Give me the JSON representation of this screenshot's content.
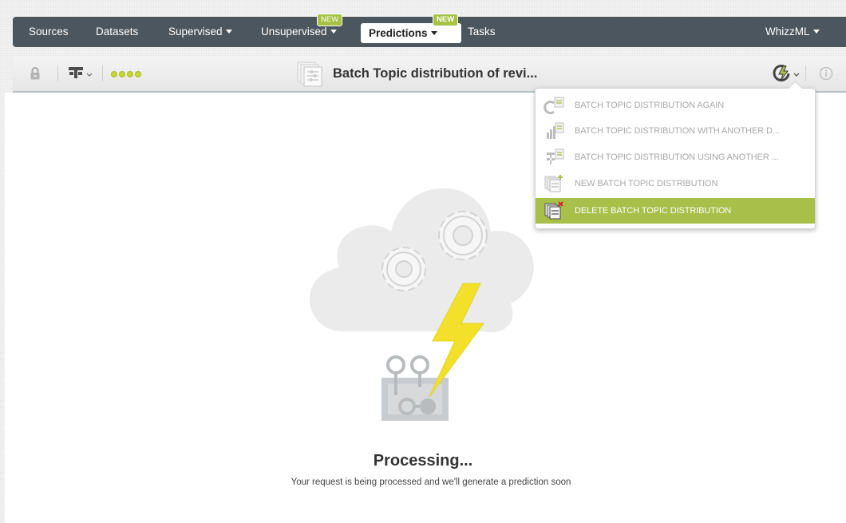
{
  "nav": {
    "items": [
      {
        "label": "Sources"
      },
      {
        "label": "Datasets"
      },
      {
        "label": "Supervised"
      },
      {
        "label": "Unsupervised",
        "badge": "NEW"
      },
      {
        "label": "Predictions",
        "badge": "NEW"
      },
      {
        "label": "Tasks"
      }
    ],
    "user_menu": "WhizzML"
  },
  "toolbar": {
    "title": "Batch Topic distribution of revi...",
    "lock_icon": "lock-icon",
    "tree_icon": "model-tree-icon",
    "actions_icon": "lightning-actions-icon",
    "info_icon": "info-icon"
  },
  "menu": {
    "items": [
      {
        "label": "BATCH TOPIC DISTRIBUTION AGAIN",
        "icon": "rerun-icon"
      },
      {
        "label": "BATCH TOPIC DISTRIBUTION WITH ANOTHER D...",
        "icon": "dataset-bars-icon"
      },
      {
        "label": "BATCH TOPIC DISTRIBUTION USING ANOTHER ...",
        "icon": "model-tree-icon"
      },
      {
        "label": "NEW BATCH TOPIC DISTRIBUTION",
        "icon": "new-batch-icon"
      },
      {
        "label": "DELETE BATCH TOPIC DISTRIBUTION",
        "icon": "delete-batch-icon"
      }
    ]
  },
  "status": {
    "title": "Processing...",
    "message": "Your request is being processed and we'll generate a prediction soon"
  },
  "colors": {
    "nav_bg": "#4b565f",
    "accent_green": "#a8bf49",
    "bolt_yellow": "#f2e02a"
  }
}
